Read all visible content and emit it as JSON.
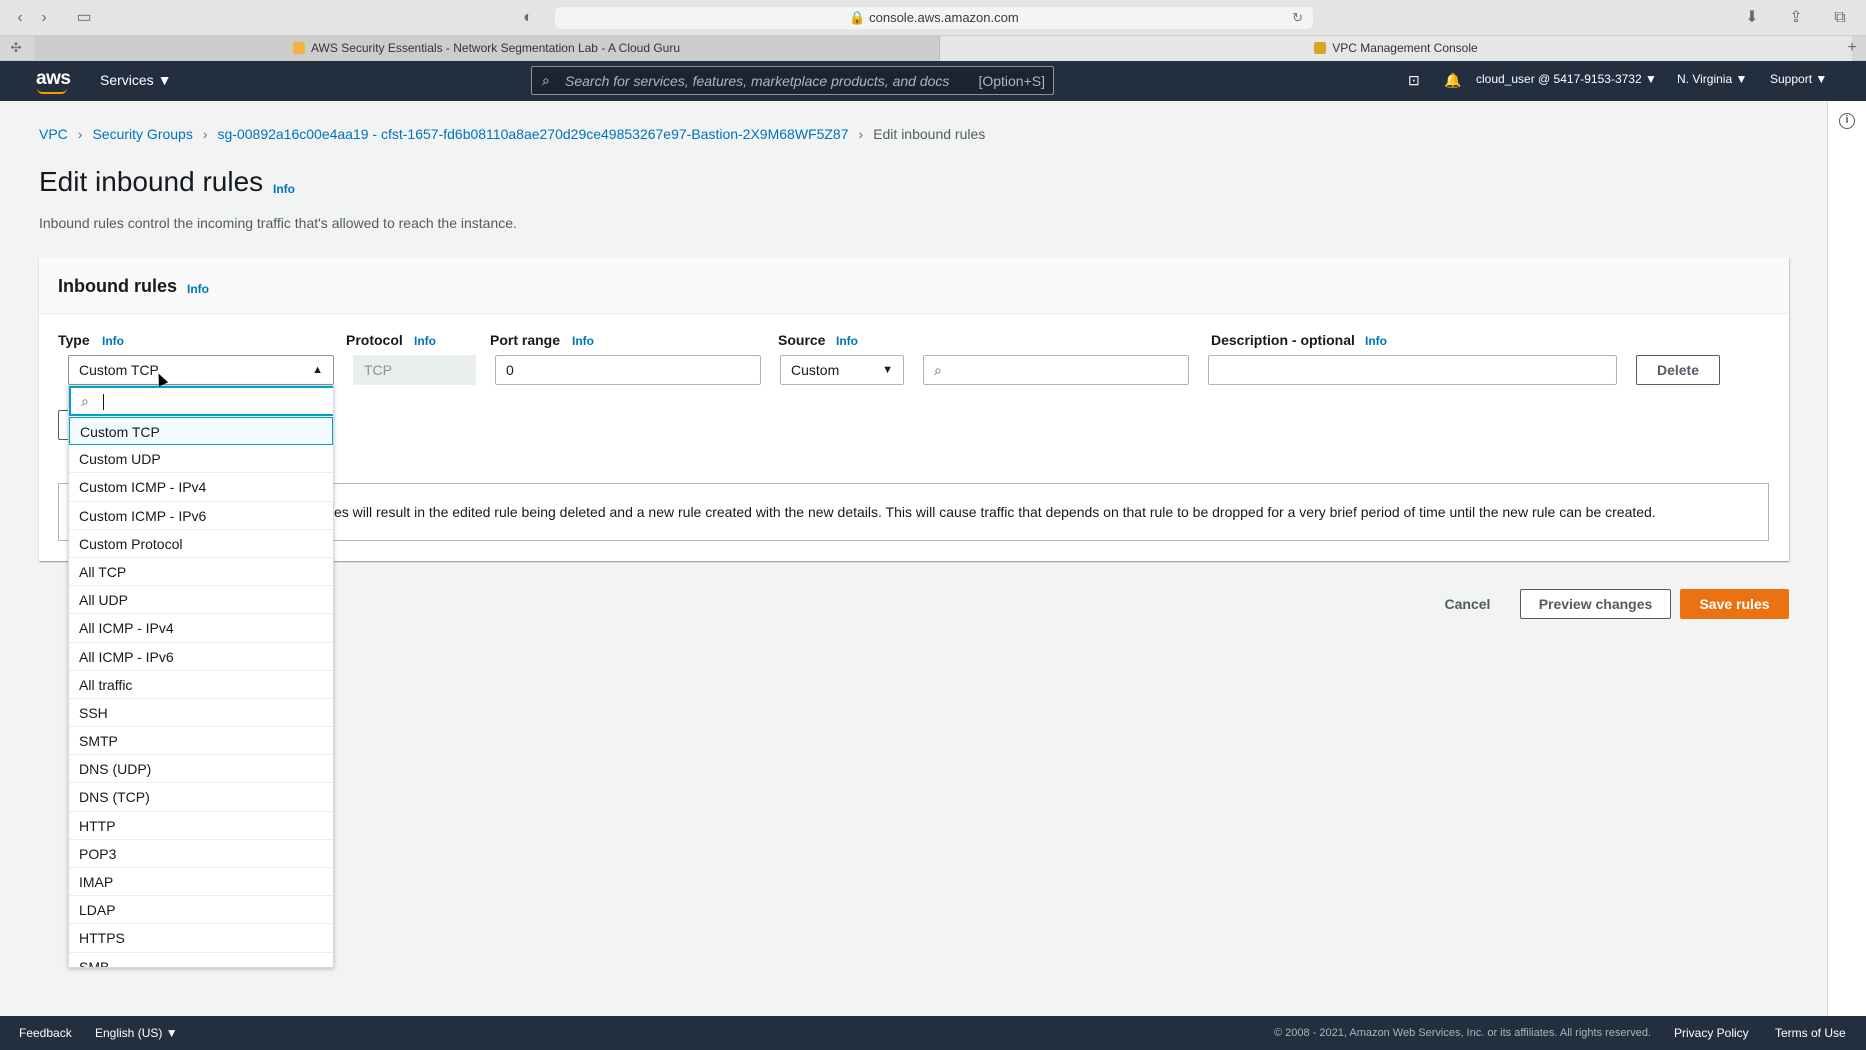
{
  "browser": {
    "url": "console.aws.amazon.com",
    "tabs": [
      {
        "label": "AWS Security Essentials - Network Segmentation Lab - A Cloud Guru"
      },
      {
        "label": "VPC Management Console"
      }
    ]
  },
  "nav": {
    "logo": "aws",
    "services_label": "Services",
    "search_placeholder": "Search for services, features, marketplace products, and docs",
    "search_shortcut": "[Option+S]",
    "account": "cloud_user @ 5417-9153-3732",
    "region": "N. Virginia",
    "support": "Support"
  },
  "breadcrumb": {
    "items": [
      "VPC",
      "Security Groups",
      "sg-00892a16c00e4aa19 - cfst-1657-fd6b08110a8ae270d29ce49853267e97-Bastion-2X9M68WF5Z87"
    ],
    "current": "Edit inbound rules"
  },
  "page": {
    "title": "Edit inbound rules",
    "info": "Info",
    "description": "Inbound rules control the incoming traffic that's allowed to reach the instance."
  },
  "panel": {
    "title": "Inbound rules",
    "info": "Info",
    "columns": {
      "type": "Type",
      "protocol": "Protocol",
      "port_range": "Port range",
      "source": "Source",
      "description": "Description - optional"
    },
    "row": {
      "type": "Custom TCP",
      "protocol": "TCP",
      "port_range": "0",
      "source": "Custom",
      "cidr": "",
      "description": "",
      "delete_label": "Delete"
    },
    "alert": "es will result in the edited rule being deleted and a new rule created with the new details. This will cause traffic that depends on that rule to be dropped for a very brief period of time until the new rule can be created."
  },
  "dropdown": {
    "filter_value": "",
    "selected": "Custom TCP",
    "options": [
      "Custom TCP",
      "Custom UDP",
      "Custom ICMP - IPv4",
      "Custom ICMP - IPv6",
      "Custom Protocol",
      "All TCP",
      "All UDP",
      "All ICMP - IPv4",
      "All ICMP - IPv6",
      "All traffic",
      "SSH",
      "SMTP",
      "DNS (UDP)",
      "DNS (TCP)",
      "HTTP",
      "POP3",
      "IMAP",
      "LDAP",
      "HTTPS",
      "SMB"
    ]
  },
  "actions": {
    "cancel": "Cancel",
    "preview": "Preview changes",
    "save": "Save rules"
  },
  "footer": {
    "feedback": "Feedback",
    "language": "English (US)",
    "copyright": "© 2008 - 2021, Amazon Web Services, Inc. or its affiliates. All rights reserved.",
    "privacy": "Privacy Policy",
    "terms": "Terms of Use"
  },
  "colors": {
    "nav_bg": "#232f3e",
    "link": "#0073bb",
    "primary": "#ec7211",
    "focus": "#00a1c9"
  }
}
